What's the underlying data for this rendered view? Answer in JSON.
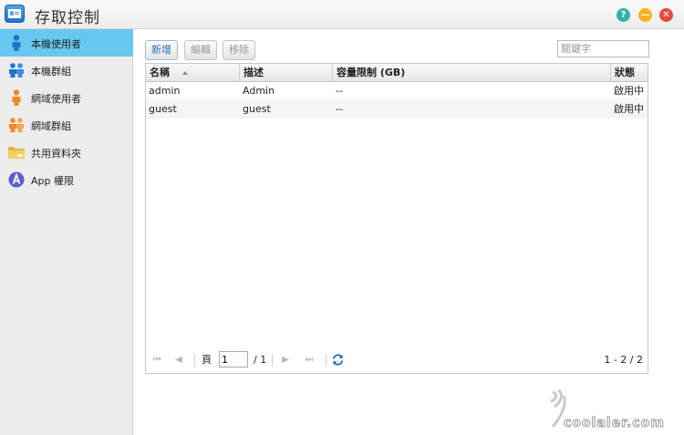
{
  "window": {
    "title": "存取控制",
    "help_label": "?",
    "min_label": "—",
    "close_label": "✕"
  },
  "sidebar": {
    "items": [
      {
        "label": "本機使用者",
        "icon": "local-user-icon"
      },
      {
        "label": "本機群組",
        "icon": "local-group-icon"
      },
      {
        "label": "網域使用者",
        "icon": "domain-user-icon"
      },
      {
        "label": "網域群組",
        "icon": "domain-group-icon"
      },
      {
        "label": "共用資料夾",
        "icon": "shared-folder-icon"
      },
      {
        "label": "App 權限",
        "icon": "app-permission-icon"
      }
    ],
    "active_index": 0
  },
  "toolbar": {
    "add_label": "新增",
    "edit_label": "編輯",
    "remove_label": "移除",
    "search_placeholder": "關鍵字"
  },
  "table": {
    "columns": [
      "名稱",
      "描述",
      "容量限制 (GB)",
      "狀態"
    ],
    "rows": [
      {
        "name": "admin",
        "description": "Admin",
        "quota": "--",
        "status": "啟用中"
      },
      {
        "name": "guest",
        "description": "guest",
        "quota": "--",
        "status": "啟用中"
      }
    ]
  },
  "pager": {
    "page_label": "頁",
    "current_page": "1",
    "total": "/ 1",
    "range": "1 - 2 / 2"
  },
  "watermark": {
    "text": "coolaler.com"
  },
  "colors": {
    "accent": "#66c8ef",
    "link": "#1e6fb5",
    "help": "#2fb2a6",
    "minimize": "#f2b11c",
    "close": "#e54d3b"
  }
}
